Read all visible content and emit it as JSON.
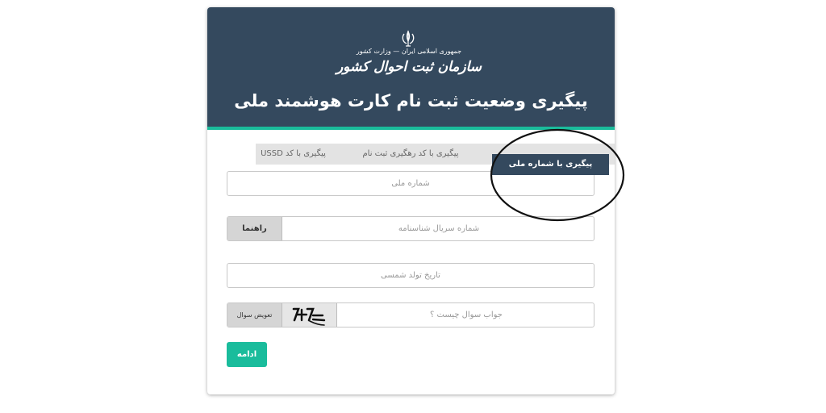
{
  "header": {
    "org_line_small": "جمهوری اسلامی ایران — وزارت کشور",
    "org_name": "سازمان ثبت احوال کشور",
    "title": "پیگیری وضعیت ثبت نام کارت هوشمند ملی"
  },
  "tabs": [
    {
      "label": "پیگیری با شماره ملی",
      "active": true
    },
    {
      "label": "پیگیری با کد رهگیری ثبت نام",
      "active": false
    },
    {
      "label": "پیگیری با کد USSD",
      "active": false
    }
  ],
  "form": {
    "national_id_placeholder": "شماره ملی",
    "serial_placeholder": "شماره سریال شناسنامه",
    "guide_label": "راهنما",
    "birth_date_placeholder": "تاریخ تولد شمسی",
    "captcha_placeholder": "جواب سوال چیست ؟",
    "change_question_label": "تعویض سوال",
    "captcha_text": "۷+۷=",
    "continue_label": "ادامه"
  },
  "colors": {
    "header_bg": "#34495e",
    "accent": "#1abc9c",
    "tab_inactive": "#e3e3e3"
  },
  "icons": {
    "emblem": "iran-emblem-icon"
  }
}
